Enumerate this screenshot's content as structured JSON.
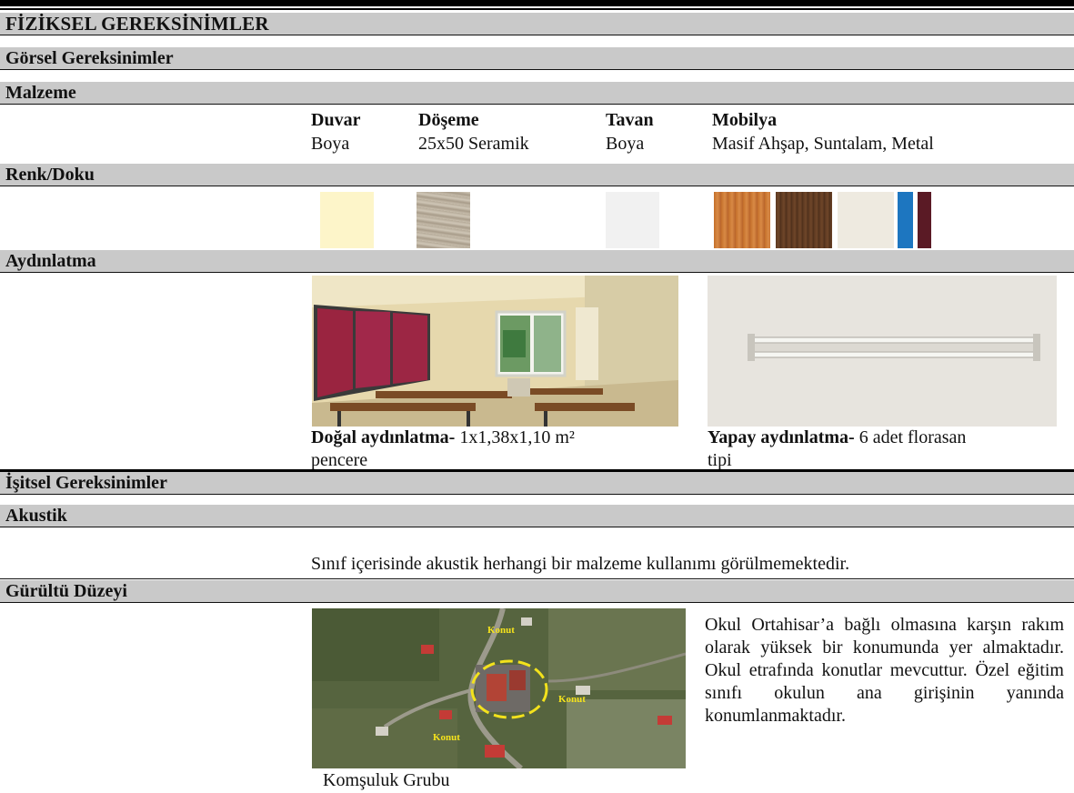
{
  "title": "FİZİKSEL GEREKSİNİMLER",
  "visual": {
    "heading": "Görsel Gereksinimler",
    "material": {
      "heading": "Malzeme",
      "columns": [
        {
          "label": "Duvar",
          "value": "Boya"
        },
        {
          "label": "Döşeme",
          "value": "25x50 Seramik"
        },
        {
          "label": "Tavan",
          "value": "Boya"
        },
        {
          "label": "Mobilya",
          "value": "Masif Ahşap, Suntalam, Metal"
        }
      ]
    },
    "color_texture": {
      "heading": "Renk/Doku",
      "swatches": {
        "duvar": "#fdf5c9",
        "doseme": "#b9ae9c",
        "tavan": "#f1f1f1",
        "mobilya_1": "#c7732e",
        "mobilya_2": "#5e3a22",
        "mobilya_3": "#eeeae0",
        "mobilya_4": "#1d76c0",
        "mobilya_5": "#5a1a25"
      }
    },
    "lighting": {
      "heading": "Aydınlatma",
      "natural_label": "Doğal aydınlatma-",
      "natural_text_1": "1x1,38x1,10 m²",
      "natural_text_2": "pencere",
      "artificial_label": "Yapay aydınlatma-",
      "artificial_text_1": "6 adet florasan",
      "artificial_text_2": "tipi"
    }
  },
  "auditory": {
    "heading": "İşitsel Gereksinimler",
    "acoustic": {
      "heading": "Akustik",
      "text": "Sınıf içerisinde akustik herhangi bir malzeme kullanımı görülmemektedir."
    },
    "noise": {
      "heading": "Gürültü Düzeyi",
      "map_labels": [
        "Konut",
        "Konut",
        "Konut"
      ],
      "caption": "Komşuluk Grubu",
      "paragraph": "Okul Ortahisar’a bağlı olmasına karşın rakım olarak yüksek bir konumunda yer almaktadır. Okul etrafında konutlar mevcuttur. Özel eğitim sınıfı okulun ana girişinin yanında konumlanmaktadır."
    }
  }
}
